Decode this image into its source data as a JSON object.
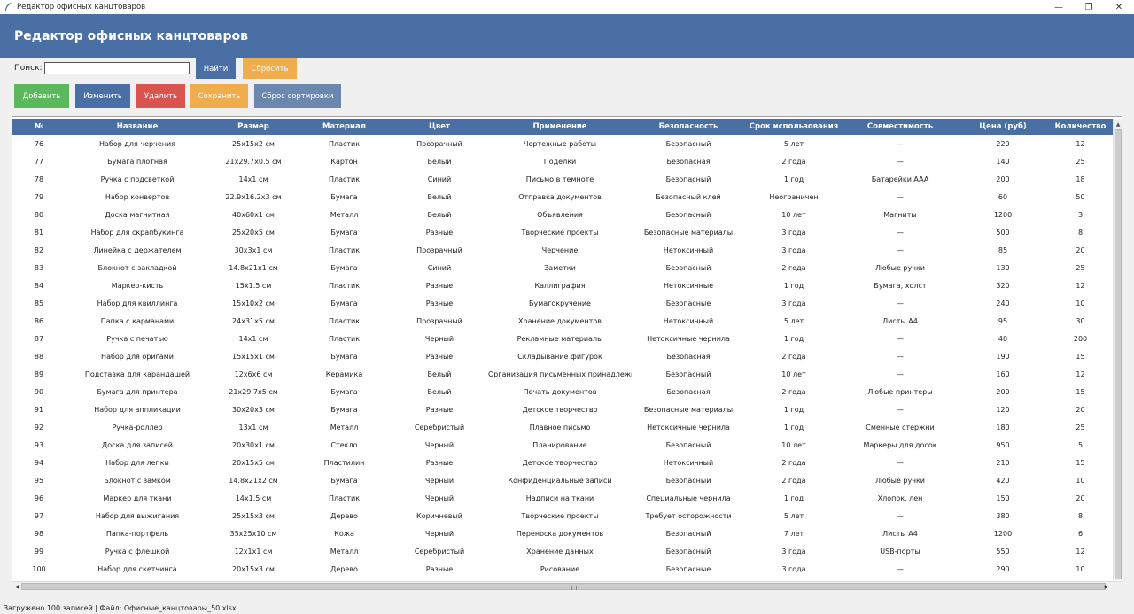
{
  "window": {
    "title": "Редактор офисных канцтоваров",
    "controls": [
      "—",
      "❐",
      "✕"
    ]
  },
  "header": {
    "title": "Редактор офисных канцтоваров"
  },
  "search": {
    "label": "Поиск:",
    "value": "",
    "find_label": "Найти",
    "reset_label": "Сбросить"
  },
  "toolbar": {
    "add_label": "Добавить",
    "edit_label": "Изменить",
    "delete_label": "Удалить",
    "save_label": "Сохранить",
    "sort_reset_label": "Сброс сортировки"
  },
  "colors": {
    "header_bg": "#4a6fa5",
    "add": "#5cb85c",
    "edit": "#4a6fa5",
    "delete": "#d9534f",
    "save": "#f0ad4e",
    "sort_reset": "#6c87ad"
  },
  "table": {
    "columns": [
      "№",
      "Название",
      "Размер",
      "Материал",
      "Цвет",
      "Применение",
      "Безопасность",
      "Срок использования",
      "Совместимость",
      "Цена (руб)",
      "Количество"
    ],
    "rows": [
      [
        "76",
        "Набор для черчения",
        "25x15x2 см",
        "Пластик",
        "Прозрачный",
        "Чертежные работы",
        "Безопасный",
        "5 лет",
        "—",
        "220",
        "12"
      ],
      [
        "77",
        "Бумага плотная",
        "21x29.7x0.5 см",
        "Картон",
        "Белый",
        "Поделки",
        "Безопасная",
        "2 года",
        "—",
        "140",
        "25"
      ],
      [
        "78",
        "Ручка с подсветкой",
        "14x1 см",
        "Пластик",
        "Синий",
        "Письмо в темноте",
        "Безопасный",
        "1 год",
        "Батарейки AAA",
        "200",
        "18"
      ],
      [
        "79",
        "Набор конвертов",
        "22.9x16.2x3 см",
        "Бумага",
        "Белый",
        "Отправка документов",
        "Безопасный клей",
        "Неограничен",
        "—",
        "60",
        "50"
      ],
      [
        "80",
        "Доска магнитная",
        "40x60x1 см",
        "Металл",
        "Белый",
        "Объявления",
        "Безопасный",
        "10 лет",
        "Магниты",
        "1200",
        "3"
      ],
      [
        "81",
        "Набор для скрапбукинга",
        "25x20x5 см",
        "Бумага",
        "Разные",
        "Творческие проекты",
        "Безопасные материалы",
        "3 года",
        "—",
        "500",
        "8"
      ],
      [
        "82",
        "Линейка с держателем",
        "30x3x1 см",
        "Пластик",
        "Прозрачный",
        "Черчение",
        "Нетоксичный",
        "3 года",
        "—",
        "85",
        "20"
      ],
      [
        "83",
        "Блокнот с закладкой",
        "14.8x21x1 см",
        "Бумага",
        "Синий",
        "Заметки",
        "Безопасный",
        "2 года",
        "Любые ручки",
        "130",
        "25"
      ],
      [
        "84",
        "Маркер-кисть",
        "15x1.5 см",
        "Пластик",
        "Разные",
        "Каллиграфия",
        "Нетоксичные",
        "1 год",
        "Бумага, холст",
        "320",
        "12"
      ],
      [
        "85",
        "Набор для квиллинга",
        "15x10x2 см",
        "Бумага",
        "Разные",
        "Бумагокручение",
        "Безопасные",
        "3 года",
        "—",
        "240",
        "10"
      ],
      [
        "86",
        "Папка с карманами",
        "24x31x5 см",
        "Пластик",
        "Прозрачный",
        "Хранение документов",
        "Нетоксичный",
        "5 лет",
        "Листы А4",
        "95",
        "30"
      ],
      [
        "87",
        "Ручка с печатью",
        "14x1 см",
        "Пластик",
        "Черный",
        "Рекламные материалы",
        "Нетоксичные чернила",
        "1 год",
        "—",
        "40",
        "200"
      ],
      [
        "88",
        "Набор для оригами",
        "15x15x1 см",
        "Бумага",
        "Разные",
        "Складывание фигурок",
        "Безопасная",
        "2 года",
        "—",
        "190",
        "15"
      ],
      [
        "89",
        "Подставка для карандашей",
        "12x6x6 см",
        "Керамика",
        "Белый",
        "Организация письменных принадлежностей",
        "Безопасный",
        "10 лет",
        "—",
        "160",
        "12"
      ],
      [
        "90",
        "Бумага для принтера",
        "21x29.7x5 см",
        "Бумага",
        "Белый",
        "Печать документов",
        "Безопасная",
        "2 года",
        "Любые принтеры",
        "200",
        "15"
      ],
      [
        "91",
        "Набор для аппликации",
        "30x20x3 см",
        "Бумага",
        "Разные",
        "Детское творчество",
        "Безопасные материалы",
        "1 год",
        "—",
        "120",
        "20"
      ],
      [
        "92",
        "Ручка-роллер",
        "13x1 см",
        "Металл",
        "Серебристый",
        "Плавное письмо",
        "Нетоксичные чернила",
        "1 год",
        "Сменные стержни",
        "180",
        "25"
      ],
      [
        "93",
        "Доска для записей",
        "20x30x1 см",
        "Стекло",
        "Черный",
        "Планирование",
        "Безопасный",
        "10 лет",
        "Маркеры для досок",
        "950",
        "5"
      ],
      [
        "94",
        "Набор для лепки",
        "20x15x5 см",
        "Пластилин",
        "Разные",
        "Детское творчество",
        "Нетоксичный",
        "2 года",
        "—",
        "210",
        "15"
      ],
      [
        "95",
        "Блокнот с замком",
        "14.8x21x2 см",
        "Бумага",
        "Черный",
        "Конфиденциальные записи",
        "Безопасный",
        "2 года",
        "Любые ручки",
        "420",
        "10"
      ],
      [
        "96",
        "Маркер для ткани",
        "14x1.5 см",
        "Пластик",
        "Черный",
        "Надписи на ткани",
        "Специальные чернила",
        "1 год",
        "Хлопок, лен",
        "150",
        "20"
      ],
      [
        "97",
        "Набор для выжигания",
        "25x15x3 см",
        "Дерево",
        "Коричневый",
        "Творческие проекты",
        "Требует осторожности",
        "5 лет",
        "—",
        "380",
        "8"
      ],
      [
        "98",
        "Папка-портфель",
        "35x25x10 см",
        "Кожа",
        "Черный",
        "Переноска документов",
        "Безопасный",
        "7 лет",
        "Листы А4",
        "1200",
        "6"
      ],
      [
        "99",
        "Ручка с флешкой",
        "12x1x1 см",
        "Металл",
        "Серебристый",
        "Хранение данных",
        "Безопасный",
        "3 года",
        "USB-порты",
        "550",
        "12"
      ],
      [
        "100",
        "Набор для скетчинга",
        "20x15x3 см",
        "Дерево",
        "Разные",
        "Рисование",
        "Безопасные",
        "3 года",
        "—",
        "290",
        "10"
      ]
    ]
  },
  "status": {
    "text": "Загружено 100 записей | Файл: Офисные_канцтовары_50.xlsx"
  }
}
